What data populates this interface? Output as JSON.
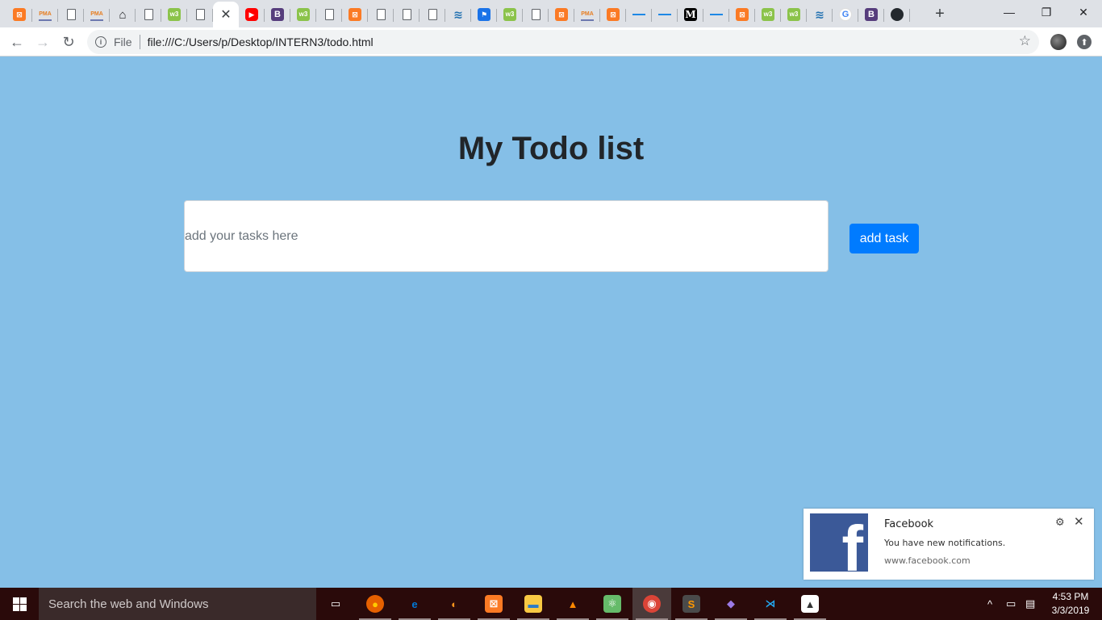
{
  "browser": {
    "tabs": [
      {
        "icon": "xampp-icon",
        "glyph": "⊠"
      },
      {
        "icon": "phpmyadmin-icon",
        "glyph": "PMA"
      },
      {
        "icon": "page-icon",
        "glyph": ""
      },
      {
        "icon": "phpmyadmin-icon",
        "glyph": "PMA"
      },
      {
        "icon": "home-icon",
        "glyph": "⌂"
      },
      {
        "icon": "page-icon",
        "glyph": ""
      },
      {
        "icon": "w3schools-icon",
        "glyph": "w3"
      },
      {
        "icon": "page-icon",
        "glyph": ""
      },
      {
        "icon": "close-icon",
        "glyph": "✕",
        "active": true
      },
      {
        "icon": "youtube-icon",
        "glyph": "▶"
      },
      {
        "icon": "bootstrap-icon",
        "glyph": "B"
      },
      {
        "icon": "w3schools-icon",
        "glyph": "w3"
      },
      {
        "icon": "page-icon",
        "glyph": ""
      },
      {
        "icon": "xampp-icon",
        "glyph": "⊠"
      },
      {
        "icon": "page-icon",
        "glyph": ""
      },
      {
        "icon": "page-icon",
        "glyph": ""
      },
      {
        "icon": "page-icon",
        "glyph": ""
      },
      {
        "icon": "wordpress-icon",
        "glyph": "≋"
      },
      {
        "icon": "flag-icon",
        "glyph": "⚑"
      },
      {
        "icon": "w3schools-icon",
        "glyph": "w3"
      },
      {
        "icon": "page-icon",
        "glyph": ""
      },
      {
        "icon": "xampp-icon",
        "glyph": "⊠"
      },
      {
        "icon": "phpmyadmin-icon",
        "glyph": "PMA"
      },
      {
        "icon": "xampp-icon",
        "glyph": "⊠"
      },
      {
        "icon": "lines-icon",
        "glyph": ""
      },
      {
        "icon": "lines-icon",
        "glyph": ""
      },
      {
        "icon": "medium-icon",
        "glyph": "M"
      },
      {
        "icon": "lines-icon",
        "glyph": ""
      },
      {
        "icon": "xampp-icon",
        "glyph": "⊠"
      },
      {
        "icon": "w3schools-icon",
        "glyph": "w3"
      },
      {
        "icon": "w3schools-icon",
        "glyph": "w3"
      },
      {
        "icon": "wordpress-icon",
        "glyph": "≋"
      },
      {
        "icon": "google-icon",
        "glyph": "G"
      },
      {
        "icon": "bootstrap-icon",
        "glyph": "B"
      },
      {
        "icon": "github-icon",
        "glyph": ""
      }
    ],
    "new_tab_glyph": "+",
    "window_controls": {
      "minimize": "—",
      "restore": "❐",
      "close": "✕"
    },
    "nav": {
      "back": "←",
      "forward": "→",
      "reload": "↻"
    },
    "address": {
      "info_glyph": "i",
      "scheme_label": "File",
      "url": "file:///C:/Users/p/Desktop/INTERN3/todo.html"
    },
    "star_glyph": "☆",
    "extension_glyph": "⬆"
  },
  "page": {
    "title": "My Todo list",
    "input": {
      "placeholder": "add your tasks here",
      "value": ""
    },
    "add_button_label": "add task",
    "background_color": "#85bfe7",
    "button_color": "#007bff"
  },
  "notification": {
    "app": "Facebook",
    "message": "You have new notifications.",
    "source": "www.facebook.com",
    "logo_glyph": "f",
    "gear_glyph": "⚙",
    "close_glyph": "✕"
  },
  "taskbar": {
    "search_placeholder": "Search the web and Windows",
    "apps": [
      {
        "name": "task-view-icon",
        "glyph": "▭"
      },
      {
        "name": "firefox-icon",
        "glyph": "●"
      },
      {
        "name": "edge-icon",
        "glyph": "e"
      },
      {
        "name": "eclipse-icon",
        "glyph": "◐"
      },
      {
        "name": "xampp-icon",
        "glyph": "⊠"
      },
      {
        "name": "file-explorer-icon",
        "glyph": "▬"
      },
      {
        "name": "vlc-icon",
        "glyph": "▲"
      },
      {
        "name": "atom-icon",
        "glyph": "⚛"
      },
      {
        "name": "chrome-icon",
        "glyph": "◉"
      },
      {
        "name": "sublime-text-icon",
        "glyph": "S"
      },
      {
        "name": "git-icon",
        "glyph": "◆"
      },
      {
        "name": "vscode-icon",
        "glyph": "⋊"
      },
      {
        "name": "photos-icon",
        "glyph": "▲"
      }
    ],
    "tray": {
      "chevron": "^",
      "battery": "▭",
      "notifications": "▤"
    },
    "time": "4:53 PM",
    "date": "3/3/2019"
  }
}
